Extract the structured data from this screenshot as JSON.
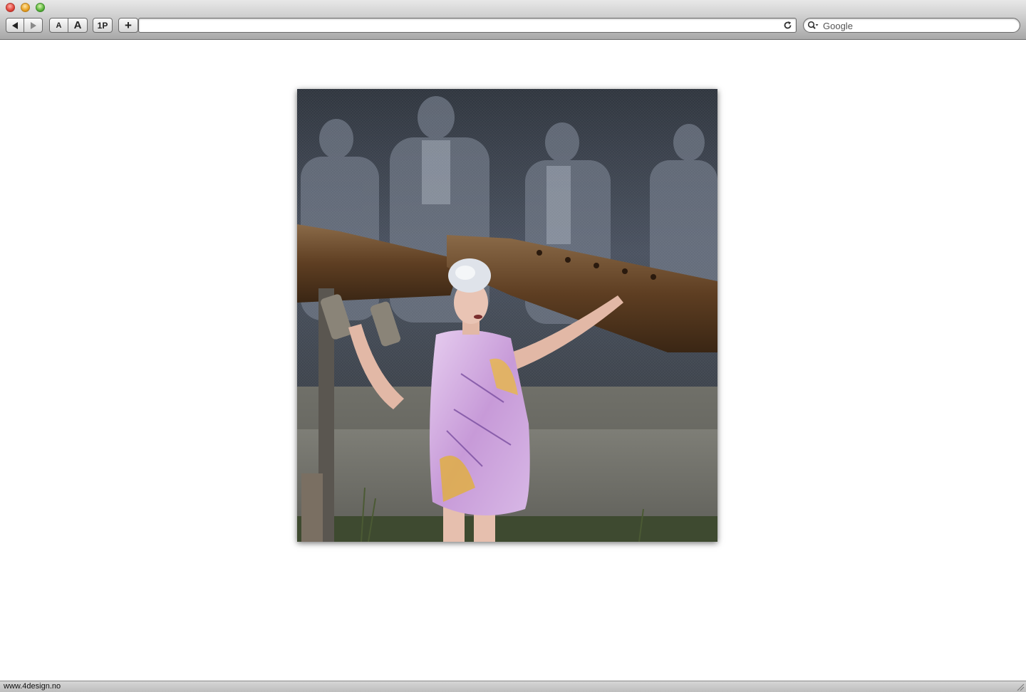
{
  "window": {
    "controls": [
      "close",
      "minimize",
      "zoom"
    ]
  },
  "toolbar": {
    "back_icon": "back-arrow-icon",
    "forward_icon": "forward-arrow-icon",
    "text_smaller_label": "A",
    "text_bigger_label": "A",
    "onepassword_label": "1P",
    "add_bookmark_label": "+",
    "address_value": "",
    "reload_icon": "reload-icon",
    "search_placeholder": "Google",
    "search_icon": "magnifier-dropdown-icon"
  },
  "content": {
    "image": {
      "subject": "fashion-photo",
      "colors": {
        "backdrop": "#3f4752",
        "rust": "#6b4a2c",
        "dress": "#d6b4e0",
        "wall": "#7a7a72"
      }
    }
  },
  "status": {
    "text": "www.4design.no"
  }
}
